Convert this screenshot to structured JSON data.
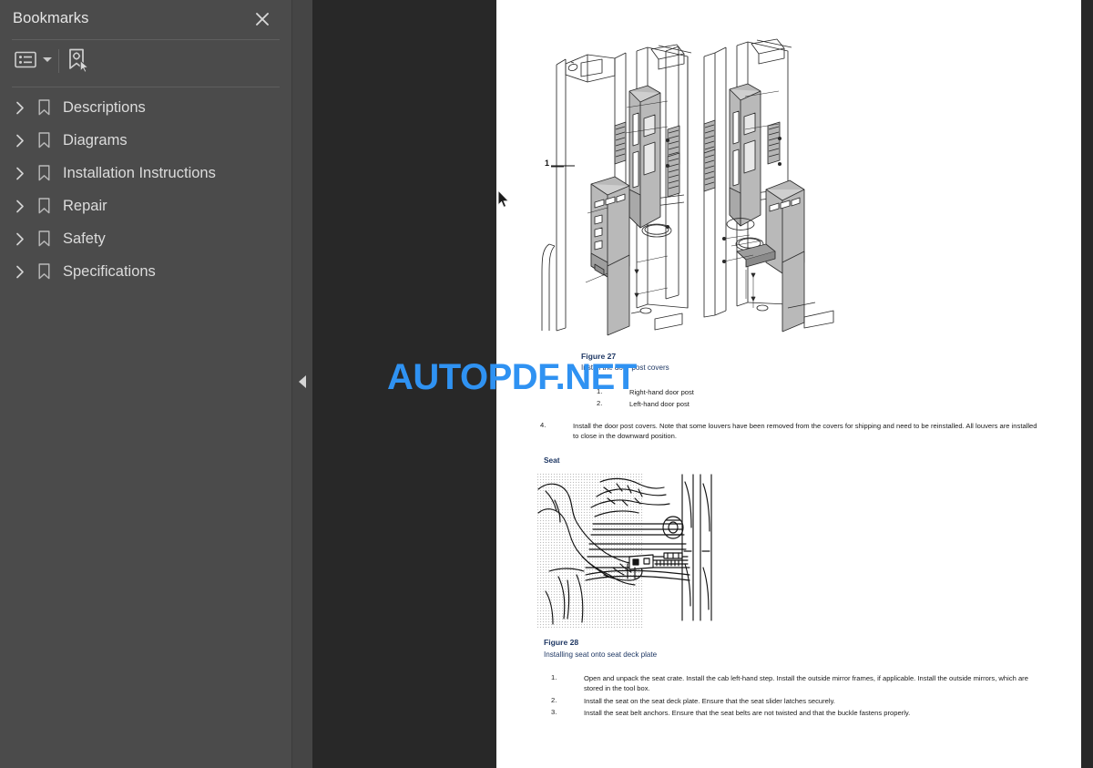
{
  "sidebar": {
    "title": "Bookmarks",
    "close_icon": "close-icon",
    "toolbar": {
      "options_label": "Bookmark options",
      "options_icon": "list-options-icon",
      "dropdown_icon": "caret-down-icon",
      "new_bookmark_label": "New bookmark",
      "new_bookmark_icon": "new-bookmark-icon"
    },
    "items": [
      {
        "label": "Descriptions",
        "expand_icon": "chevron-right-icon",
        "bookmark_icon": "bookmark-flag-icon"
      },
      {
        "label": "Diagrams",
        "expand_icon": "chevron-right-icon",
        "bookmark_icon": "bookmark-flag-icon"
      },
      {
        "label": "Installation Instructions",
        "expand_icon": "chevron-right-icon",
        "bookmark_icon": "bookmark-flag-icon"
      },
      {
        "label": "Repair",
        "expand_icon": "chevron-right-icon",
        "bookmark_icon": "bookmark-flag-icon"
      },
      {
        "label": "Safety",
        "expand_icon": "chevron-right-icon",
        "bookmark_icon": "bookmark-flag-icon"
      },
      {
        "label": "Specifications",
        "expand_icon": "chevron-right-icon",
        "bookmark_icon": "bookmark-flag-icon"
      }
    ]
  },
  "viewer": {
    "collapse_handle_icon": "collapse-left-icon",
    "background_color": "#282828",
    "panel_color": "#4b4b4b"
  },
  "watermark": {
    "text": "AUTOPDF.NET",
    "color": "#2f92f2"
  },
  "document": {
    "figure27": {
      "callout_1": "1",
      "caption_title": "Figure 27",
      "caption_subtitle": "Install the door post covers",
      "legend": [
        {
          "num": "1.",
          "text": "Right-hand door post"
        },
        {
          "num": "2.",
          "text": "Left-hand door post"
        }
      ]
    },
    "step4": {
      "num": "4.",
      "text": "Install the door post covers. Note that some louvers have been removed from the covers for shipping and need to be reinstalled. All louvers are installed to close in the downward position."
    },
    "seat_section": {
      "heading": "Seat"
    },
    "figure28": {
      "caption_title": "Figure 28",
      "caption_subtitle": "Installing seat onto seat deck plate"
    },
    "seat_steps": [
      {
        "num": "1.",
        "text": "Open and unpack the seat crate. Install the cab left-hand step. Install the outside mirror frames, if applicable. Install the outside mirrors, which are stored in the tool box."
      },
      {
        "num": "2.",
        "text": "Install the seat on the seat deck plate. Ensure that the seat slider latches securely."
      },
      {
        "num": "3.",
        "text": "Install the seat belt anchors. Ensure that the seat belts are not twisted and that the buckle fastens properly."
      }
    ]
  },
  "cursor": {
    "icon": "mouse-pointer-icon"
  }
}
